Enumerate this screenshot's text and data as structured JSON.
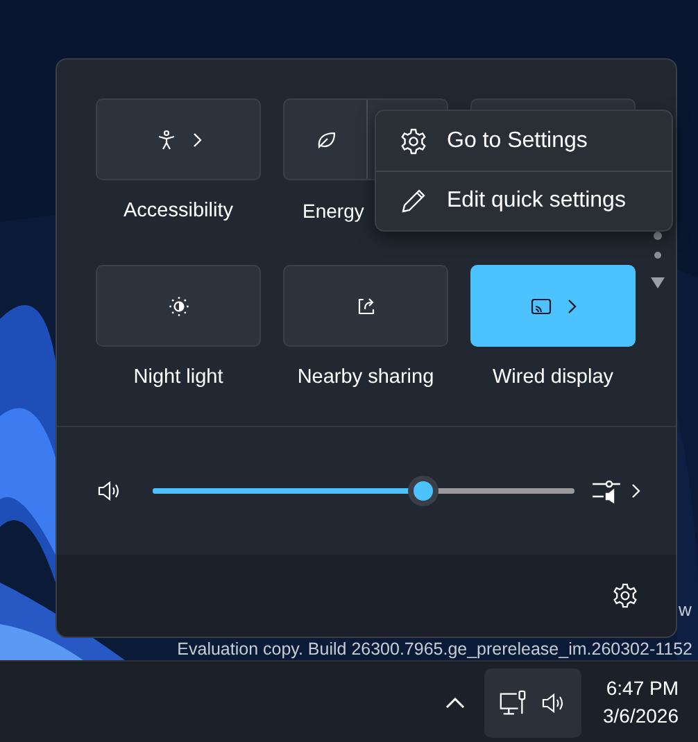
{
  "tiles": [
    {
      "kind": "accessibility",
      "label": "Accessibility",
      "on": false,
      "chevron": true
    },
    {
      "kind": "energy",
      "label": "Energy",
      "on": false,
      "chevron": false
    },
    {
      "kind": "hidden",
      "on": false
    },
    {
      "kind": "nightlight",
      "label": "Night light",
      "on": false,
      "chevron": false
    },
    {
      "kind": "sharing",
      "label": "Nearby sharing",
      "on": false,
      "chevron": false
    },
    {
      "kind": "cast",
      "label": "Wired display",
      "on": true,
      "chevron": true
    }
  ],
  "context_menu": {
    "items": [
      {
        "kind": "gear",
        "label": "Go to Settings"
      },
      {
        "kind": "pencil",
        "label": "Edit quick settings"
      }
    ]
  },
  "volume": {
    "level": 0.64
  },
  "desktop": {
    "watermark_end": "w",
    "watermark": "Evaluation copy. Build 26300.7965.ge_prerelease_im.260302-1152"
  },
  "taskbar": {
    "time": "6:47 PM",
    "date": "3/6/2026"
  }
}
